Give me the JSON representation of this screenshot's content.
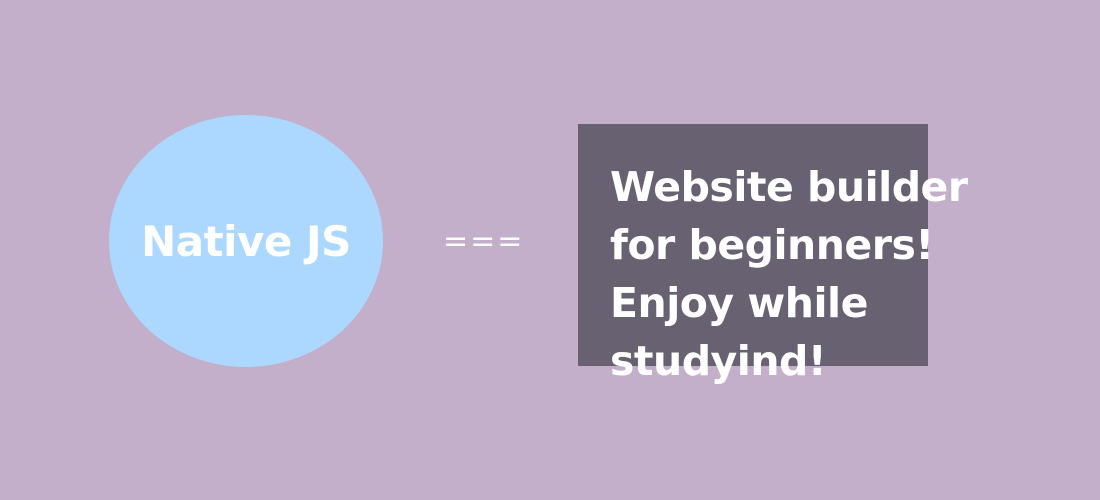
{
  "colors": {
    "background": "#c3afc9",
    "circle": "#acd7ff",
    "box": "#686172",
    "text": "#ffffff"
  },
  "circle": {
    "label": "Native JS"
  },
  "operator": {
    "symbol": "==="
  },
  "box": {
    "lines": [
      "Website builder",
      "for beginners!",
      "Enjoy while",
      "studyind!"
    ]
  }
}
